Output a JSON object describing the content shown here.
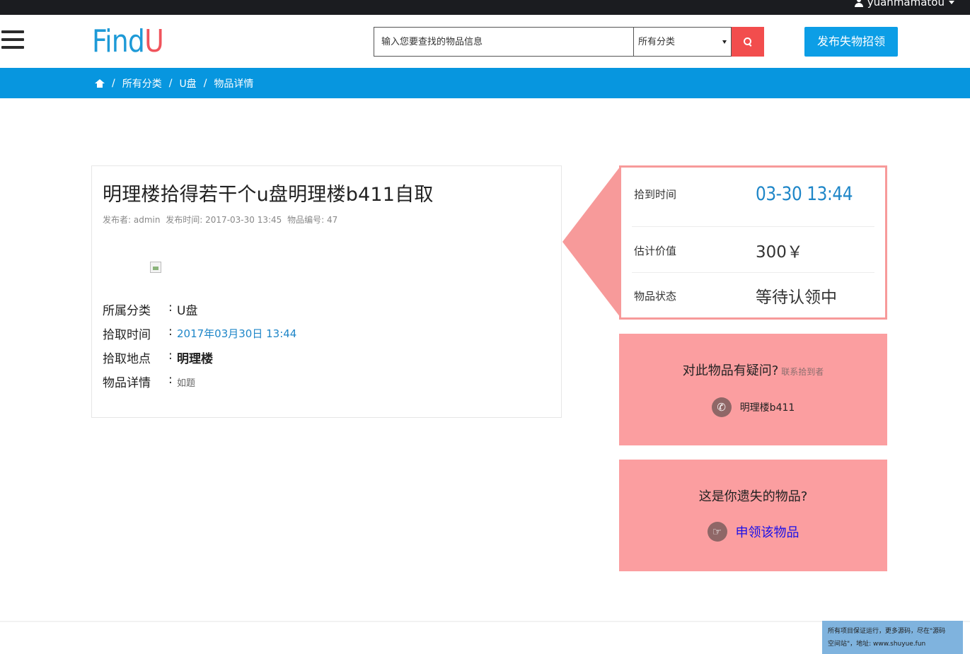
{
  "topbar": {
    "username": "yuanmamatou"
  },
  "header": {
    "logo_find": "Find",
    "logo_u": "U",
    "search_placeholder": "输入您要查找的物品信息",
    "category_selected": "所有分类",
    "publish_label": "发布失物招领"
  },
  "breadcrumb": {
    "items": [
      "所有分类",
      "U盘",
      "物品详情"
    ],
    "sep": "/"
  },
  "item": {
    "title": "明理楼拾得若干个u盘明理楼b411自取",
    "meta": {
      "publisher": "发布者: admin",
      "publish_time": "发布时间: 2017-03-30 13:45",
      "item_no": "物品编号: 47"
    },
    "fields": [
      {
        "key": "所属分类",
        "colon": ":",
        "value": "U盘"
      },
      {
        "key": "拾取时间",
        "colon": ":",
        "value": "2017年03月30日 13:44"
      },
      {
        "key": "拾取地点",
        "colon": ":",
        "value": "明理楼"
      },
      {
        "key": "物品详情",
        "colon": ":",
        "value": "如题"
      }
    ]
  },
  "info": {
    "rows": [
      {
        "label": "拾到时间",
        "value": "03-30 13:44"
      },
      {
        "label": "估计价值",
        "value": "300￥"
      },
      {
        "label": "物品状态",
        "value": "等待认领中"
      }
    ]
  },
  "contact": {
    "question": "对此物品有疑问?",
    "hint": "联系拾到者",
    "phone_text": "明理楼b411"
  },
  "claim": {
    "question": "这是你遗失的物品?",
    "action": "申领该物品"
  },
  "footer_note": {
    "line1": "所有项目保证运行，更多源码，尽在\"源码",
    "line2": "空间站\"，地址: www.shuyue.fun"
  },
  "colors": {
    "primary_blue": "#0796df",
    "search_red": "#f24d4d",
    "pink": "#fb9ea0",
    "pink_border": "#f79a9a",
    "time_blue": "#1e86c8"
  }
}
